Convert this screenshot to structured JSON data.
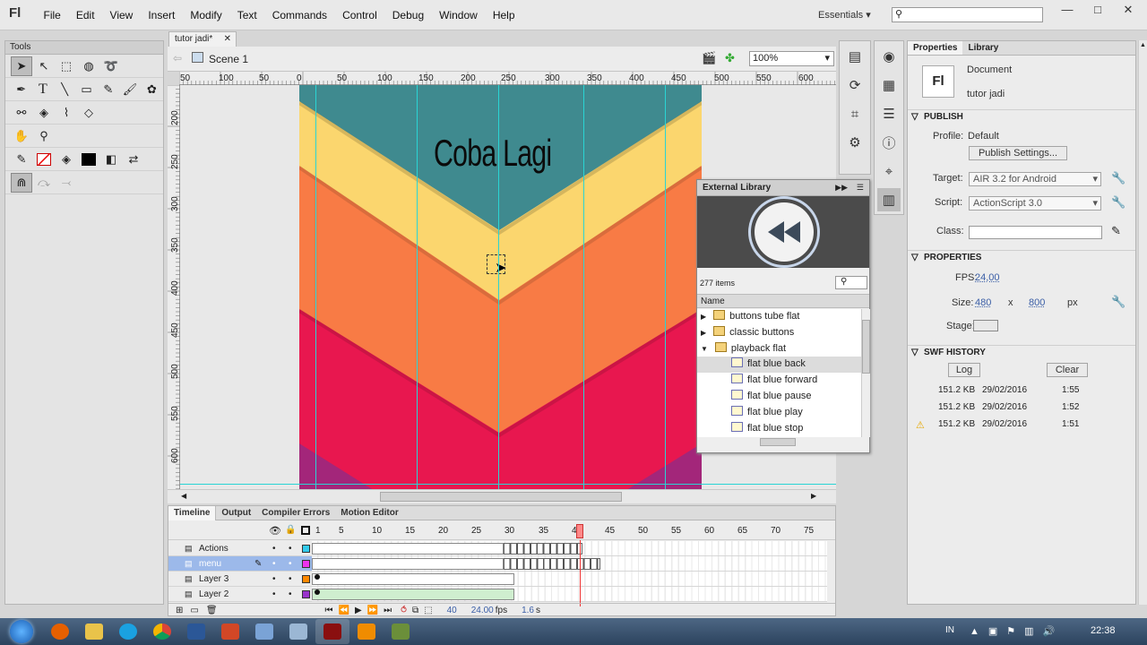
{
  "app": {
    "logo": "Fl",
    "menu": [
      "File",
      "Edit",
      "View",
      "Insert",
      "Modify",
      "Text",
      "Commands",
      "Control",
      "Debug",
      "Window",
      "Help"
    ],
    "workspace": "Essentials"
  },
  "tools": {
    "title": "Tools"
  },
  "document": {
    "tab_label": "tutor jadi*",
    "scene_label": "Scene 1",
    "zoom": "100%",
    "ruler_top": [
      "50",
      "100",
      "50",
      "0",
      "50",
      "100",
      "150",
      "200",
      "250",
      "300",
      "350",
      "400",
      "450",
      "500",
      "550",
      "600"
    ],
    "ruler_left": [
      "200",
      "250",
      "300",
      "350",
      "400",
      "450",
      "500",
      "550",
      "600"
    ],
    "stage_text": "Coba Lagi"
  },
  "timeline": {
    "tabs": [
      "Timeline",
      "Output",
      "Compiler Errors",
      "Motion Editor"
    ],
    "frame_numbers": [
      "1",
      "5",
      "10",
      "15",
      "20",
      "25",
      "30",
      "35",
      "40",
      "45",
      "50",
      "55",
      "60",
      "65",
      "70",
      "75"
    ],
    "layers": [
      {
        "name": "Actions",
        "color": "#33ccee"
      },
      {
        "name": "menu",
        "color": "#ee33ee"
      },
      {
        "name": "Layer 3",
        "color": "#ff8800"
      },
      {
        "name": "Layer 2",
        "color": "#9933cc"
      }
    ],
    "current_frame": "40",
    "fps": "24.00",
    "fps_unit": "fps",
    "time": "1.6",
    "time_unit": "s"
  },
  "external_library": {
    "title": "External Library",
    "count": "277 items",
    "column": "Name",
    "items": [
      {
        "label": "buttons tube flat",
        "type": "folder",
        "indent": 0,
        "expand": "▶"
      },
      {
        "label": "classic buttons",
        "type": "folder",
        "indent": 0,
        "expand": "▶"
      },
      {
        "label": "playback flat",
        "type": "folder-open",
        "indent": 0,
        "expand": "▼"
      },
      {
        "label": "flat blue back",
        "type": "symbol",
        "indent": 1,
        "expand": ""
      },
      {
        "label": "flat blue forward",
        "type": "symbol",
        "indent": 1,
        "expand": ""
      },
      {
        "label": "flat blue pause",
        "type": "symbol",
        "indent": 1,
        "expand": ""
      },
      {
        "label": "flat blue play",
        "type": "symbol",
        "indent": 1,
        "expand": ""
      },
      {
        "label": "flat blue stop",
        "type": "symbol",
        "indent": 1,
        "expand": ""
      }
    ]
  },
  "properties": {
    "tabs": [
      "Properties",
      "Library"
    ],
    "doc_icon": "Fl",
    "doc_type": "Document",
    "doc_name": "tutor jadi",
    "publish": {
      "header": "PUBLISH",
      "profile_label": "Profile:",
      "profile_value": "Default",
      "publish_settings": "Publish Settings...",
      "target_label": "Target:",
      "target_value": "AIR 3.2 for Android",
      "script_label": "Script:",
      "script_value": "ActionScript 3.0",
      "class_label": "Class:"
    },
    "props": {
      "header": "PROPERTIES",
      "fps_label": "FPS:",
      "fps_value": "24,00",
      "size_label": "Size:",
      "width": "480",
      "x": "x",
      "height": "800",
      "unit": "px",
      "stage_label": "Stage:"
    },
    "swf_history": {
      "header": "SWF HISTORY",
      "log": "Log",
      "clear": "Clear",
      "rows": [
        {
          "size": "151.2 KB",
          "date": "29/02/2016",
          "time": "1:55",
          "warn": false
        },
        {
          "size": "151.2 KB",
          "date": "29/02/2016",
          "time": "1:52",
          "warn": false
        },
        {
          "size": "151.2 KB",
          "date": "29/02/2016",
          "time": "1:51",
          "warn": true
        }
      ]
    }
  },
  "taskbar": {
    "lang": "IN",
    "clock": "22:38"
  },
  "colors": {
    "stage_teal": "#3f8a8f",
    "stage_yellow": "#fbd66e",
    "stage_orange": "#f87b45",
    "stage_pink": "#e8174f",
    "stage_purple": "#a3267a",
    "guide": "#2ad4d4"
  }
}
